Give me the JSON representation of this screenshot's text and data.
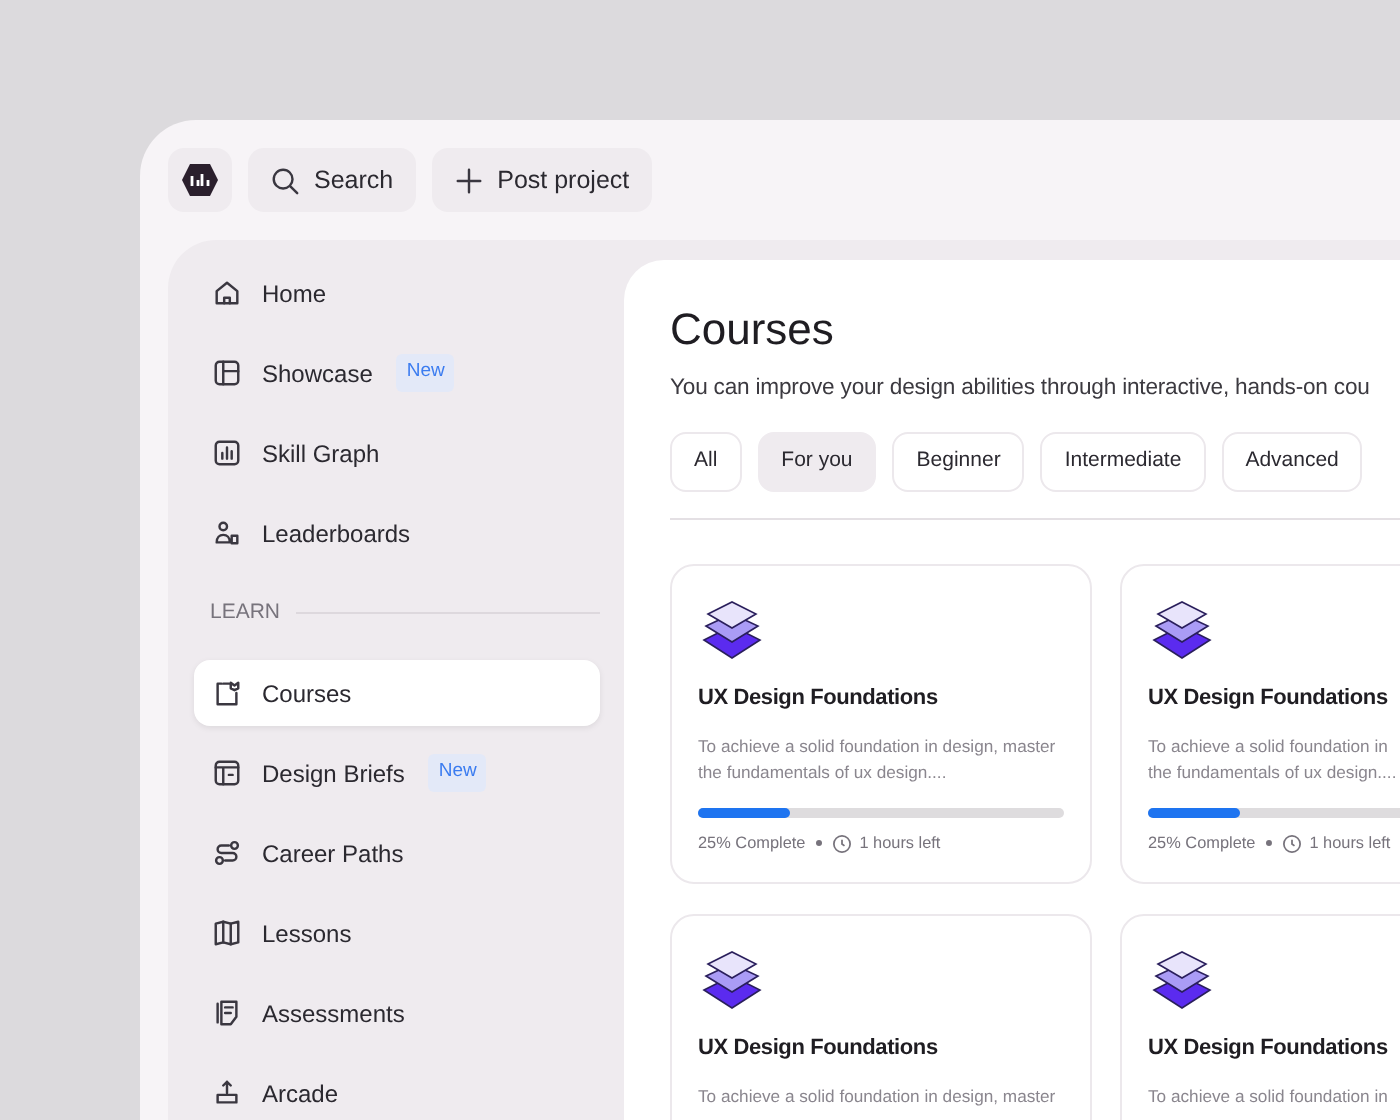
{
  "topbar": {
    "search_label": "Search",
    "post_label": "Post project"
  },
  "sidebar": {
    "items": [
      {
        "label": "Home",
        "selected": false
      },
      {
        "label": "Showcase",
        "badge": "New",
        "selected": false
      },
      {
        "label": "Skill Graph",
        "selected": false
      },
      {
        "label": "Leaderboards",
        "selected": false
      }
    ],
    "section_title": "LEARN",
    "learn_items": [
      {
        "label": "Courses",
        "selected": true
      },
      {
        "label": "Design Briefs",
        "badge": "New",
        "selected": false
      },
      {
        "label": "Career Paths",
        "selected": false
      },
      {
        "label": "Lessons",
        "selected": false
      },
      {
        "label": "Assessments",
        "selected": false
      },
      {
        "label": "Arcade",
        "selected": false
      }
    ]
  },
  "main": {
    "title": "Courses",
    "subtitle": "You can improve your design abilities through interactive, hands-on cou",
    "filters": [
      {
        "label": "All",
        "selected": false
      },
      {
        "label": "For you",
        "selected": true
      },
      {
        "label": "Beginner",
        "selected": false
      },
      {
        "label": "Intermediate",
        "selected": false
      },
      {
        "label": "Advanced",
        "selected": false
      }
    ],
    "courses": [
      {
        "title": "UX Design Foundations",
        "description_lines": [
          "To achieve a solid foundation in design, master",
          "the fundamentals of ux design...."
        ],
        "progress": {
          "level": 0.25,
          "label": "25% Complete",
          "time_left": "1 hours left"
        }
      },
      {
        "title": "UX Design Foundations",
        "description_lines": [
          "To achieve a solid foundation in",
          "the fundamentals of ux design...."
        ],
        "progress": {
          "level": 0.25,
          "label": "25% Complete",
          "time_left": "1 hours left"
        }
      },
      {
        "title": "UX Design Foundations",
        "description_lines": [
          "To achieve a solid foundation in design, master"
        ]
      },
      {
        "title": "UX Design Foundations",
        "description_lines": [
          "To achieve a solid foundation in"
        ]
      }
    ]
  }
}
